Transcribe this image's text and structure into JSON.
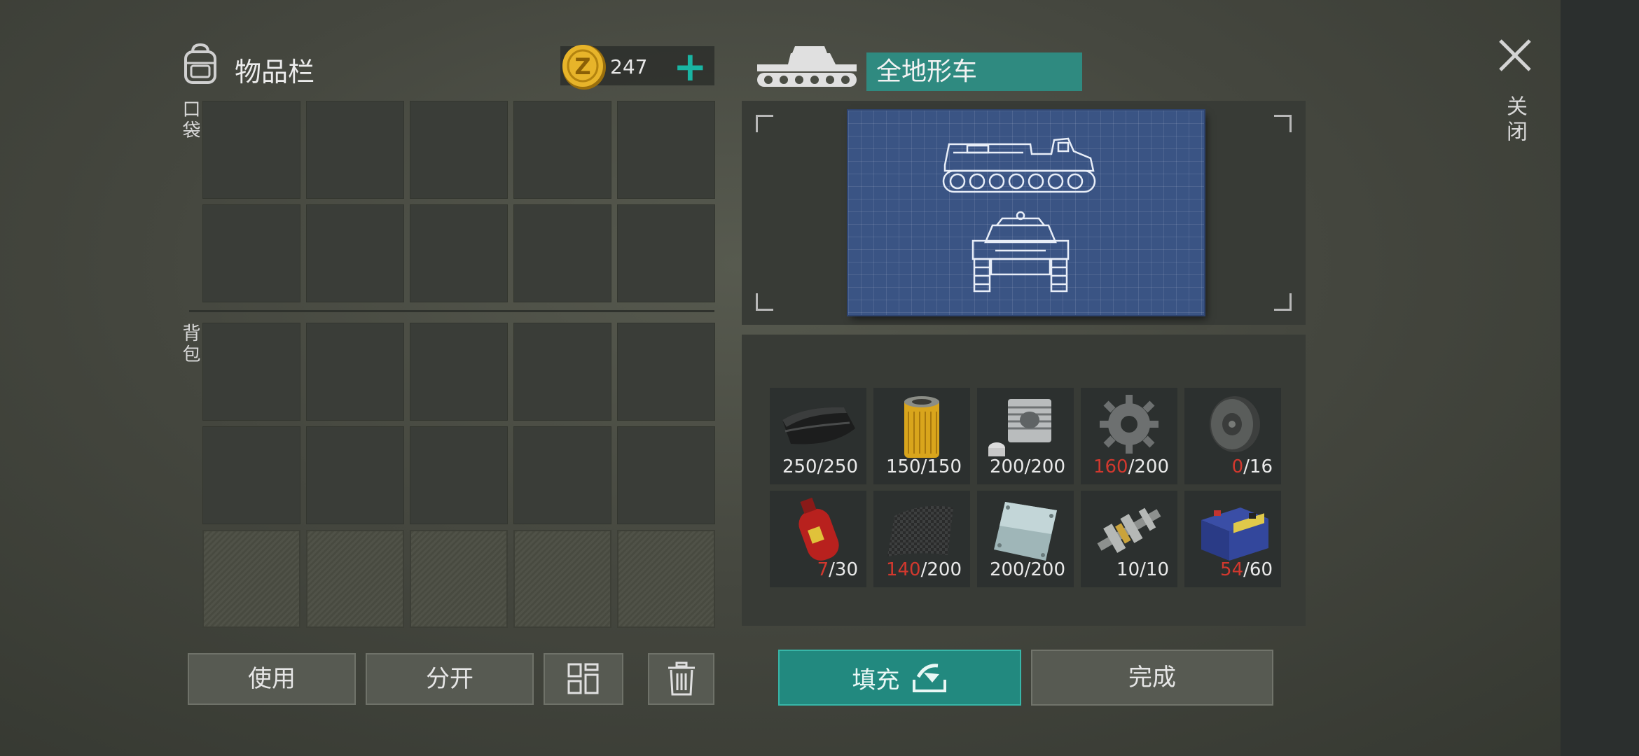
{
  "inventory": {
    "title": "物品栏",
    "currency_amount": "247",
    "currency_plus": "+",
    "pocket_label": "口袋",
    "backpack_label": "背包",
    "pocket_rows": 2,
    "backpack_rows": 2,
    "locked_rows": 1,
    "columns": 5
  },
  "buttons": {
    "use": "使用",
    "split": "分开",
    "fill": "填充",
    "done": "完成"
  },
  "vehicle": {
    "name": "全地形车"
  },
  "materials": [
    {
      "icon": "rubber-sheet-icon",
      "have": "250",
      "need": "250",
      "short": false
    },
    {
      "icon": "oil-filter-icon",
      "have": "150",
      "need": "150",
      "short": false
    },
    {
      "icon": "engine-cylinder-icon",
      "have": "200",
      "need": "200",
      "short": false
    },
    {
      "icon": "gear-icon",
      "have": "160",
      "need": "200",
      "short": true
    },
    {
      "icon": "wheel-icon",
      "have": "0",
      "need": "16",
      "short": true
    },
    {
      "icon": "gas-cylinder-icon",
      "have": "7",
      "need": "30",
      "short": true
    },
    {
      "icon": "carbon-fiber-icon",
      "have": "140",
      "need": "200",
      "short": true
    },
    {
      "icon": "metal-plate-icon",
      "have": "200",
      "need": "200",
      "short": false
    },
    {
      "icon": "crankshaft-icon",
      "have": "10",
      "need": "10",
      "short": false
    },
    {
      "icon": "battery-icon",
      "have": "54",
      "need": "60",
      "short": true
    }
  ],
  "close_label": "关闭",
  "colors": {
    "accent": "#22897f",
    "accent_light": "#19b5a3",
    "shortage": "#d2382e"
  }
}
